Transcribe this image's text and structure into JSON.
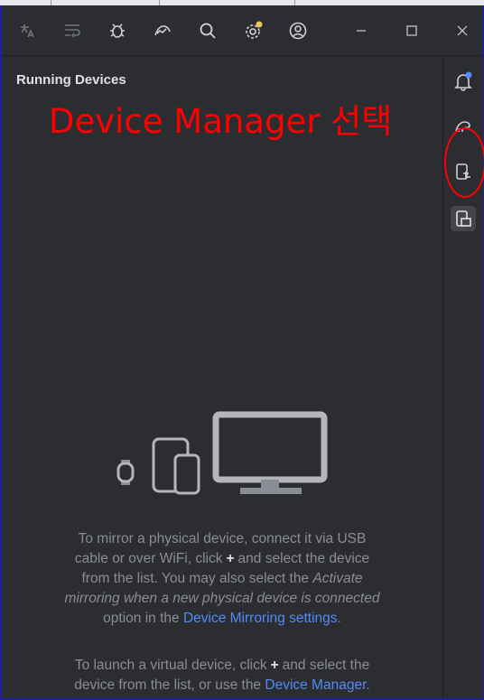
{
  "panel": {
    "title": "Running Devices"
  },
  "annotation": {
    "text": "Device Manager 선택"
  },
  "toolbar": {
    "icons": [
      "translate-icon",
      "wrap-icon",
      "bug-icon",
      "profiler-icon",
      "search-icon",
      "settings-icon",
      "account-icon",
      "minimize-icon",
      "maximize-icon",
      "close-icon"
    ]
  },
  "right_bar": {
    "icons": [
      "notifications-icon",
      "gradle-icon",
      "device-manager-icon",
      "running-devices-icon"
    ]
  },
  "message": {
    "line1": "To mirror a physical device, connect it via USB",
    "line2": "cable or over WiFi, click",
    "plus": "+",
    "line2b": "and select the device",
    "line3a": "from the list. You may also select the",
    "line3_em": "Activate",
    "line4_em": "mirroring when a new physical device is connected",
    "line5a": "option in the",
    "line5_link": "Device Mirroring settings",
    "line5b": ".",
    "v_line1a": "To launch a virtual device, click",
    "v_plus": "+",
    "v_line1b": "and select the",
    "v_line2a": "device from the list, or use the",
    "v_line2_link": "Device Manager",
    "v_line2b": "."
  },
  "colors": {
    "accent": "#548af7",
    "annotation": "#ff0000",
    "background": "#2b2d30"
  }
}
